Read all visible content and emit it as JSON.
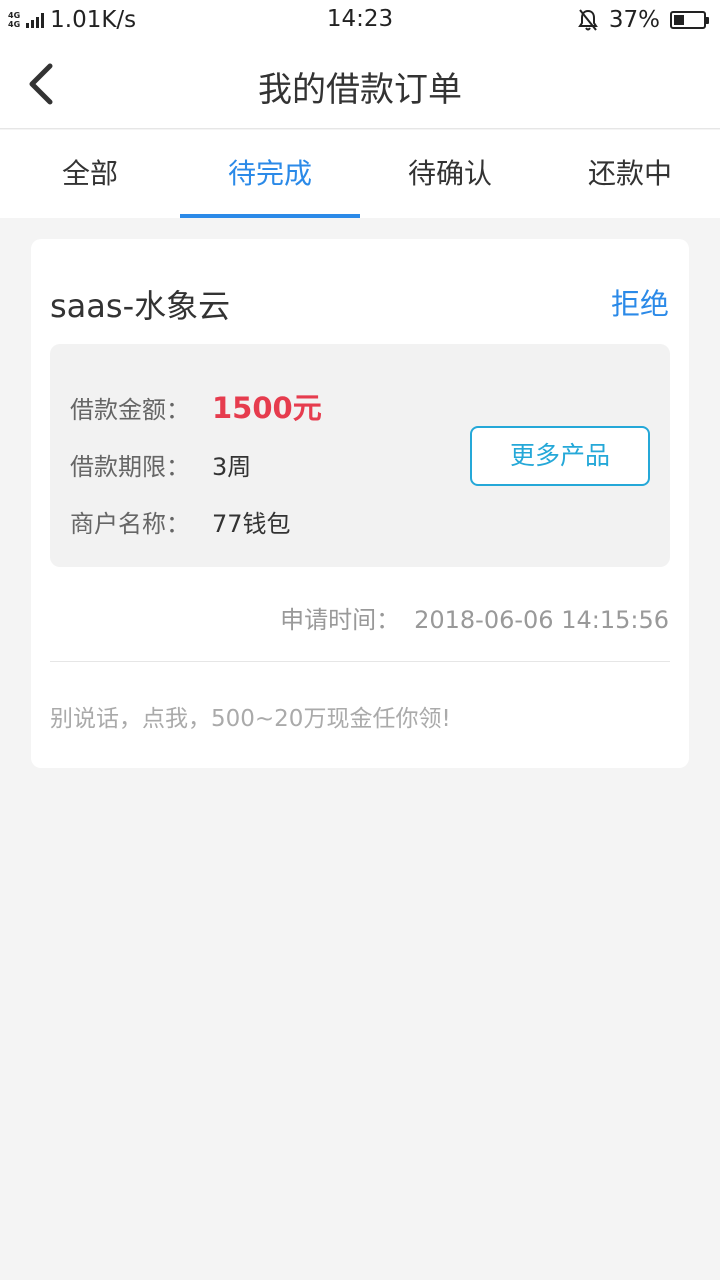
{
  "status_bar": {
    "network_tags": [
      "4G",
      "4G"
    ],
    "net_speed": "1.01K/s",
    "time": "14:23",
    "battery_percent_text": "37%",
    "battery_level": 0.37,
    "icons": [
      "signal-icon",
      "mute-icon",
      "battery-icon"
    ]
  },
  "header": {
    "title": "我的借款订单",
    "back_icon": "chevron-left-icon"
  },
  "tabs": [
    {
      "label": "全部",
      "active": false
    },
    {
      "label": "待完成",
      "active": true
    },
    {
      "label": "待确认",
      "active": false
    },
    {
      "label": "还款中",
      "active": false
    }
  ],
  "order": {
    "vendor": "saas-水象云",
    "reject_label": "拒绝",
    "amount_label": "借款金额：",
    "amount_value": "1500元",
    "term_label": "借款期限：",
    "term_value": "3周",
    "merchant_label": "商户名称：",
    "merchant_value": "77钱包",
    "more_button": "更多产品",
    "apply_time_label": "申请时间：",
    "apply_time_value": "2018-06-06 14:15:56",
    "promo_text": "别说话，点我，500~20万现金任你领!"
  },
  "colors": {
    "accent": "#2b8ae8",
    "amount": "#e63c4e",
    "button_border": "#25a8d8",
    "background": "#f4f4f4"
  }
}
